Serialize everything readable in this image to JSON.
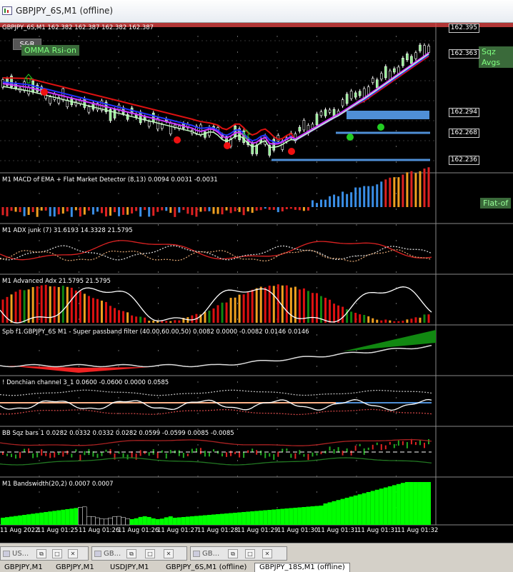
{
  "window": {
    "title": "GBPJPY_6S,M1 (offline)"
  },
  "main": {
    "info": "GBPJPY_6S,M1  162.382 162.387 162.382 162.387",
    "sr_button": "S&R",
    "omma_label": "OMMA Rsi-on",
    "sqz_label": "Sqz Avgs",
    "prices": [
      "162.395",
      "162.363",
      "162.294",
      "162.268",
      "162.236"
    ]
  },
  "subwindows": [
    {
      "label": "M1  MACD of EMA + Flat Market Detector (8,13) 0.0094 0.0031 -0.0031",
      "badge": "Flat-of"
    },
    {
      "label": "M1  ADX junk (7) 31.6193 14.3328 21.5795"
    },
    {
      "label": "M1  Advanced Adx 21.5795 21.5795"
    },
    {
      "label": "Spb f1.GBPJPY_6S M1 - Super passband filter (40.00,60.00,50) 0.0082 0.0000 -0.0082 0.0146 0.0146"
    },
    {
      "label": "! Donchian channel 3_1 0.0600 -0.0600 0.0000 0.0585"
    },
    {
      "label": "BB Sqz bars 1 0.0282 0.0332 0.0332 0.0282 0.0599 -0.0599 0.0085 -0.0085"
    },
    {
      "label": "M1  Bandswidth(20,2) 0.0007 0.0007"
    }
  ],
  "time_axis": [
    "11 Aug 2022",
    "11 Aug 01:25",
    "11 Aug 01:26",
    "11 Aug 01:26",
    "11 Aug 01:27",
    "11 Aug 01:28",
    "11 Aug 01:29",
    "11 Aug 01:30",
    "11 Aug 01:31",
    "11 Aug 01:31",
    "11 Aug 01:32"
  ],
  "mdi_windows": [
    {
      "name": "US..."
    },
    {
      "name": "GB..."
    },
    {
      "name": "GB..."
    }
  ],
  "tabs": [
    {
      "label": "GBPJPY,M1",
      "active": false
    },
    {
      "label": "GBPJPY,M1",
      "active": false
    },
    {
      "label": "USDJPY,M1",
      "active": false
    },
    {
      "label": "GBPJPY_6S,M1 (offline)",
      "active": false
    },
    {
      "label": "GBPJPY_18S,M1 (offline)",
      "active": true
    }
  ],
  "colors": {
    "candle_up": "#ffffff",
    "candle_body": "#90ee90",
    "red_ma": "#dd1111",
    "blue_ma": "#2233ff",
    "violet_ma": "#cc33ff",
    "green_ma": "#c8ffc8",
    "adv_red": "#dd1111",
    "adv_orange": "#f0a020",
    "adv_green": "#118811",
    "bandswidth": "#00ff00"
  }
}
